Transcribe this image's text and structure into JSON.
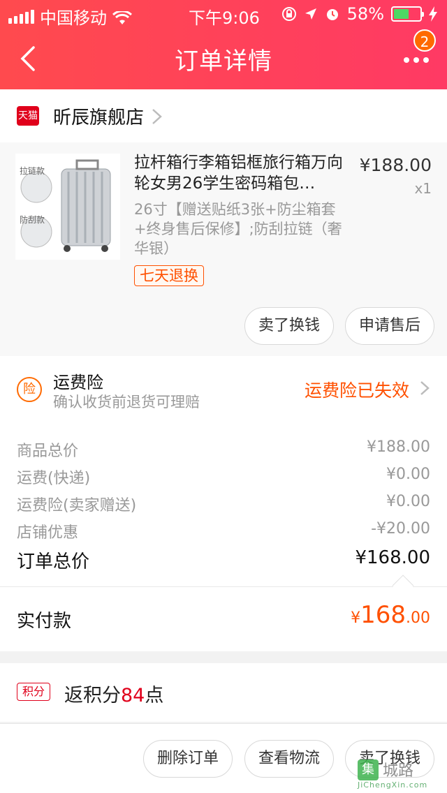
{
  "status_bar": {
    "carrier": "中国移动",
    "time": "下午9:06",
    "battery_percent": "58%",
    "battery_level": 0.58,
    "battery_color": "#4cd964"
  },
  "nav": {
    "title": "订单详情",
    "back_icon": "chevron-left-icon",
    "more_icon": "more-dots-icon",
    "badge": "2"
  },
  "shop": {
    "logo_text": "天猫",
    "name": "昕辰旗舰店"
  },
  "product": {
    "image_labels": [
      "拉链款",
      "防刮款"
    ],
    "title": "拉杆箱行李箱铝框旅行箱万向轮女男26学生密码箱包…",
    "price": "¥188.00",
    "quantity": "x1",
    "spec": "26寸【赠送贴纸3张+防尘箱套+终身售后保修】;防刮拉链（奢华银）",
    "tag": "七天退换",
    "actions": [
      "卖了换钱",
      "申请售后"
    ]
  },
  "insurance": {
    "icon_text": "险",
    "title": "运费险",
    "subtitle": "确认收货前退货可理赔",
    "status": "运费险已失效"
  },
  "summary": {
    "rows": [
      {
        "label": "商品总价",
        "value": "¥188.00"
      },
      {
        "label": "运费(快递)",
        "value": "¥0.00"
      },
      {
        "label": "运费险(卖家赠送)",
        "value": "¥0.00"
      },
      {
        "label": "店铺优惠",
        "value": "-¥20.00"
      }
    ],
    "total_label": "订单总价",
    "total_value": "¥168.00"
  },
  "paid": {
    "label": "实付款",
    "currency": "¥",
    "amount_int": "168",
    "amount_dec": ".00"
  },
  "points": {
    "icon_text": "积分",
    "prefix": "返积分",
    "number": "84",
    "suffix": "点"
  },
  "bottom_actions": [
    "删除订单",
    "查看物流",
    "卖了换钱"
  ],
  "watermark": {
    "icon_text": "集",
    "text": "城路",
    "url": "JiChengXin.com"
  },
  "colors": {
    "header": "#ff4a4e",
    "accent": "#ff5000",
    "tmall": "#e0001b"
  }
}
